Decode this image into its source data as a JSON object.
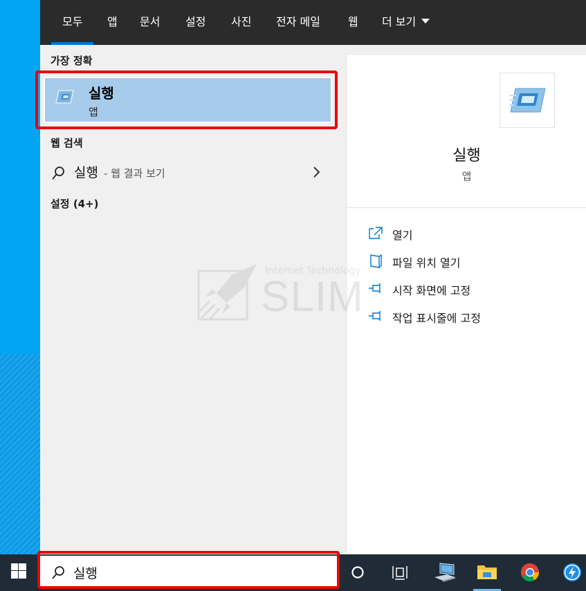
{
  "tabs": [
    {
      "label": "모두"
    },
    {
      "label": "앱"
    },
    {
      "label": "문서"
    },
    {
      "label": "설정"
    },
    {
      "label": "사진"
    },
    {
      "label": "전자 메일"
    },
    {
      "label": "웹"
    },
    {
      "label": "더 보기"
    }
  ],
  "results": {
    "best_match_heading": "가장 정확",
    "best_match": {
      "title": "실행",
      "subtitle": "앱"
    },
    "web_heading": "웹 검색",
    "web_result": {
      "query": "실행",
      "suffix": "- 웹 결과 보기"
    },
    "settings_heading": "설정 (4+)"
  },
  "detail": {
    "title": "실행",
    "subtitle": "앱",
    "actions": [
      {
        "label": "열기",
        "icon": "open-icon"
      },
      {
        "label": "파일 위치 열기",
        "icon": "file-location-icon"
      },
      {
        "label": "시작 화면에 고정",
        "icon": "pin-icon"
      },
      {
        "label": "작업 표시줄에 고정",
        "icon": "pin-icon"
      }
    ]
  },
  "watermark": {
    "caption": "Internet Technology",
    "text": "SLIM"
  },
  "search": {
    "value": "실행"
  },
  "taskbar": {
    "items": [
      "windows-start",
      "search",
      "cortana",
      "task-view",
      "this-pc",
      "file-explorer",
      "chrome",
      "pinned-app"
    ]
  },
  "colors": {
    "accent": "#0078d7",
    "selection": "#a7cbea",
    "highlight_box": "#ee0000",
    "topbar": "#2b2b2b",
    "taskbar": "#1f2b36"
  }
}
